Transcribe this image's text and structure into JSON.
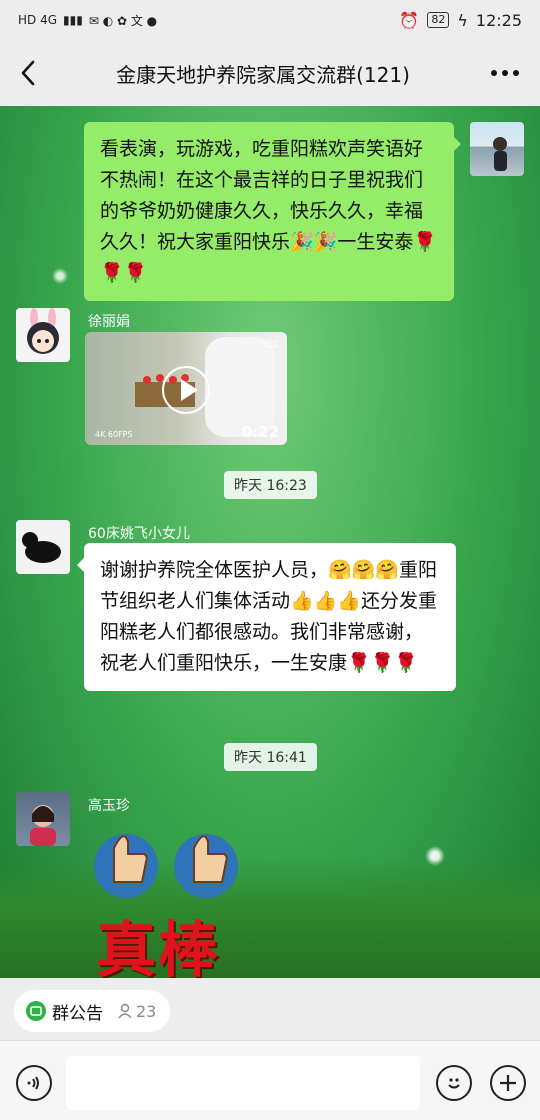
{
  "status_bar": {
    "left": "HD 4G",
    "battery": "82",
    "time": "12:25"
  },
  "header": {
    "title": "金康天地护养院家属交流群(121)"
  },
  "messages": [
    {
      "from": "me",
      "text": "看表演，玩游戏，吃重阳糕欢声笑语好不热闹！在这个最吉祥的日子里祝我们的爷爷奶奶健康久久，快乐久久，幸福久久！祝大家重阳快乐🎉🎉一生安泰🌹🌹🌹"
    },
    {
      "sender": "徐丽娟",
      "type": "video",
      "duration": "0:22",
      "badge": "4K 60FPS",
      "rec": "REC"
    },
    {
      "timestamp": "昨天 16:23"
    },
    {
      "sender": "60床姚飞小女儿",
      "text": "谢谢护养院全体医护人员，🤗🤗🤗重阳节组织老人们集体活动👍👍👍还分发重阳糕老人们都很感动。我们非常感谢，祝老人们重阳快乐，一生安康🌹🌹🌹"
    },
    {
      "timestamp": "昨天 16:41"
    },
    {
      "sender": "高玉珍",
      "type": "sticker",
      "sticker_text": "真棒"
    }
  ],
  "bottom": {
    "notice_label": "群公告",
    "member_count": "23"
  }
}
